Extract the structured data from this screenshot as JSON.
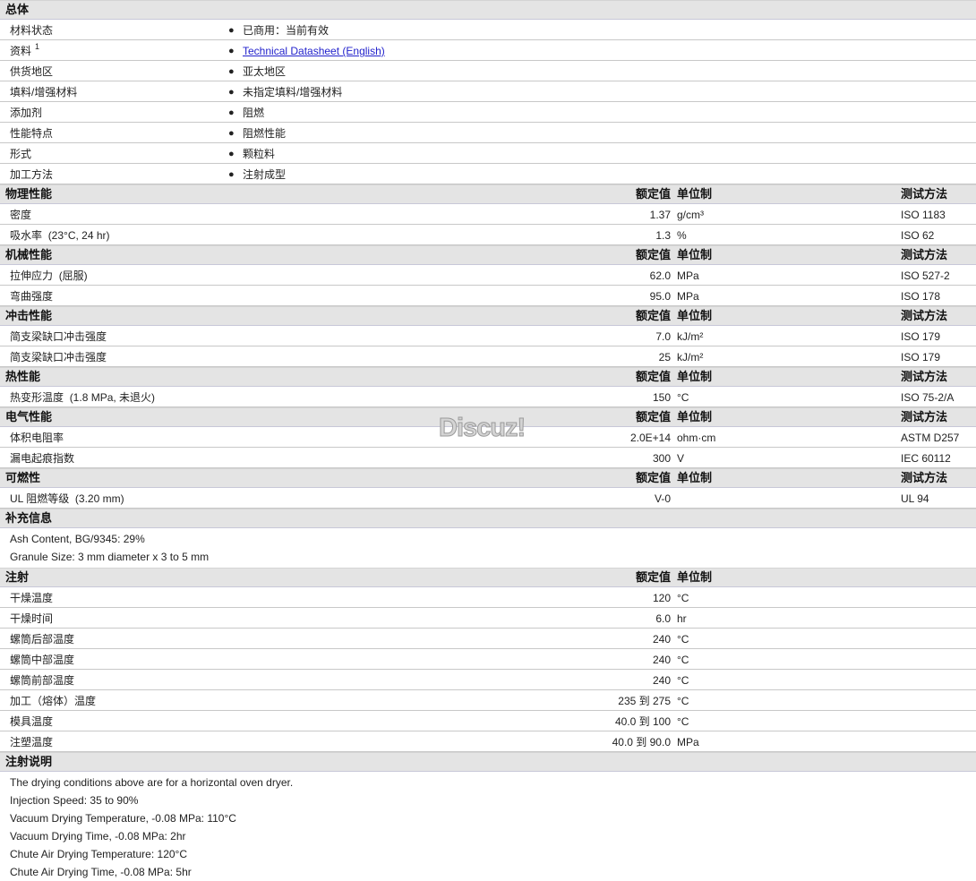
{
  "general": {
    "title": "总体",
    "rows": [
      {
        "label": "材料状态",
        "value": "已商用：当前有效"
      },
      {
        "label": "资料",
        "sup": "1",
        "value": "Technical Datasheet (English)",
        "link": true
      },
      {
        "label": "供货地区",
        "value": "亚太地区"
      },
      {
        "label": "填料/增强材料",
        "value": "未指定填料/增强材料"
      },
      {
        "label": "添加剂",
        "value": "阻燃"
      },
      {
        "label": "性能特点",
        "value": "阻燃性能"
      },
      {
        "label": "形式",
        "value": "颗粒料"
      },
      {
        "label": "加工方法",
        "value": "注射成型"
      }
    ],
    "bullet": "●"
  },
  "col_headers": {
    "nominal": "额定值",
    "unit": "单位制",
    "method": "测试方法"
  },
  "sections": [
    {
      "title": "物理性能",
      "rows": [
        {
          "label": "密度",
          "value": "1.37",
          "unit": "g/cm³",
          "method": "ISO 1183"
        },
        {
          "label": "吸水率",
          "cond": "(23°C, 24 hr)",
          "value": "1.3",
          "unit": "%",
          "method": "ISO 62"
        }
      ]
    },
    {
      "title": "机械性能",
      "rows": [
        {
          "label": "拉伸应力",
          "cond": "(屈服)",
          "value": "62.0",
          "unit": "MPa",
          "method": "ISO 527-2"
        },
        {
          "label": "弯曲强度",
          "value": "95.0",
          "unit": "MPa",
          "method": "ISO 178"
        }
      ]
    },
    {
      "title": "冲击性能",
      "rows": [
        {
          "label": "简支梁缺口冲击强度",
          "value": "7.0",
          "unit": "kJ/m²",
          "method": "ISO 179"
        },
        {
          "label": "简支梁缺口冲击强度",
          "value": "25",
          "unit": "kJ/m²",
          "method": "ISO 179"
        }
      ]
    },
    {
      "title": "热性能",
      "rows": [
        {
          "label": "热变形温度",
          "cond": "(1.8 MPa, 未退火)",
          "value": "150",
          "unit": "°C",
          "method": "ISO 75-2/A"
        }
      ]
    },
    {
      "title": "电气性能",
      "rows": [
        {
          "label": "体积电阻率",
          "value": "2.0E+14",
          "unit": "ohm·cm",
          "method": "ASTM D257"
        },
        {
          "label": "漏电起痕指数",
          "value": "300",
          "unit": "V",
          "method": "IEC 60112"
        }
      ]
    },
    {
      "title": "可燃性",
      "rows": [
        {
          "label": "UL 阻燃等级",
          "cond": "(3.20 mm)",
          "value": "V-0",
          "unit": "",
          "method": "UL 94"
        }
      ]
    }
  ],
  "supplement": {
    "title": "补充信息",
    "lines": [
      "Ash Content, BG/9345: 29%",
      "Granule Size: 3 mm diameter x 3 to 5 mm"
    ]
  },
  "injection": {
    "title": "注射",
    "rows": [
      {
        "label": "干燥温度",
        "value": "120",
        "unit": "°C"
      },
      {
        "label": "干燥时间",
        "value": "6.0",
        "unit": "hr"
      },
      {
        "label": "螺筒后部温度",
        "value": "240",
        "unit": "°C"
      },
      {
        "label": "螺筒中部温度",
        "value": "240",
        "unit": "°C"
      },
      {
        "label": "螺筒前部温度",
        "value": "240",
        "unit": "°C"
      },
      {
        "label": "加工（熔体）温度",
        "value": "235 到  275",
        "unit": "°C"
      },
      {
        "label": "模具温度",
        "value": "40.0 到  100",
        "unit": "°C"
      },
      {
        "label": "注塑温度",
        "value": "40.0 到  90.0",
        "unit": "MPa"
      }
    ]
  },
  "injection_notes": {
    "title": "注射说明",
    "lines": [
      "The drying conditions above are for a horizontal oven dryer.",
      "Injection Speed: 35 to 90%",
      "Vacuum Drying Temperature, -0.08 MPa: 110°C",
      "Vacuum Drying Time, -0.08 MPa: 2hr",
      "Chute Air Drying Temperature: 120°C",
      "Chute Air Drying Time, -0.08 MPa: 5hr"
    ]
  },
  "watermark": "Discuz!"
}
